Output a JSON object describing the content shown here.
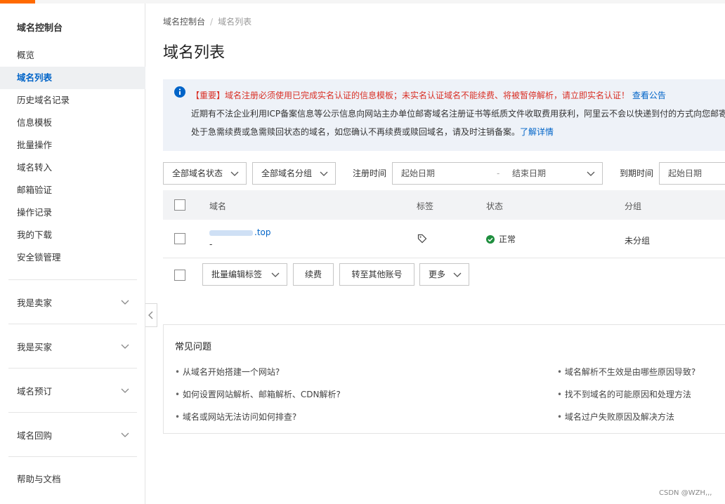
{
  "sidebar": {
    "title": "域名控制台",
    "items": [
      {
        "label": "概览"
      },
      {
        "label": "域名列表"
      },
      {
        "label": "历史域名记录"
      },
      {
        "label": "信息模板"
      },
      {
        "label": "批量操作"
      },
      {
        "label": "域名转入"
      },
      {
        "label": "邮箱验证"
      },
      {
        "label": "操作记录"
      },
      {
        "label": "我的下载"
      },
      {
        "label": "安全锁管理"
      }
    ],
    "groups": [
      {
        "label": "我是卖家",
        "icon": "chevron-down-icon"
      },
      {
        "label": "我是买家",
        "icon": "chevron-down-icon"
      },
      {
        "label": "域名预订",
        "icon": "chevron-down-icon"
      },
      {
        "label": "域名回购",
        "icon": "chevron-down-icon"
      }
    ],
    "help": "帮助与文档"
  },
  "breadcrumb": {
    "root": "域名控制台",
    "sep": "/",
    "current": "域名列表"
  },
  "page_title": "域名列表",
  "notice": {
    "important_prefix": "【重要】",
    "line1": "域名注册必须使用已完成实名认证的信息模板；未实名认证域名不能续费、将被暂停解析，请立即实名认证！",
    "line1_link": "查看公告",
    "line2": "近期有不法企业利用ICP备案信息等公示信息向网站主办单位邮寄域名注册证书等纸质文件收取费用获利，阿里云不会以快递到付的方式向您邮寄",
    "line3": "处于急需续费或急需赎回状态的域名，如您确认不再续费或赎回域名，请及时注销备案。",
    "line3_link": "了解详情"
  },
  "filters": {
    "status": "全部域名状态",
    "group": "全部域名分组",
    "reg_time_label": "注册时间",
    "reg_start": "起始日期",
    "range_sep": "-",
    "reg_end": "结束日期",
    "expire_label": "到期时间",
    "expire_start": "起始日期"
  },
  "table": {
    "columns": [
      "域名",
      "标签",
      "状态",
      "分组"
    ],
    "rows": [
      {
        "domain_suffix": ".top",
        "domain_sub": "-",
        "status": "正常",
        "group": "未分组"
      }
    ]
  },
  "bulk": {
    "edit_tags": "批量编辑标签",
    "renew": "续费",
    "transfer": "转至其他账号",
    "more": "更多"
  },
  "faq": {
    "title": "常见问题",
    "left": [
      "从域名开始搭建一个网站?",
      "如何设置网站解析、邮箱解析、CDN解析?",
      "域名或网站无法访问如何排查?"
    ],
    "right": [
      "域名解析不生效是由哪些原因导致?",
      "找不到域名的可能原因和处理方法",
      "域名过户失败原因及解决方法"
    ]
  },
  "colors": {
    "accent": "#ff6a00",
    "link": "#0064c8",
    "warning": "#d93026",
    "success": "#1e8e3e"
  },
  "watermark": "CSDN @WZH,,,"
}
